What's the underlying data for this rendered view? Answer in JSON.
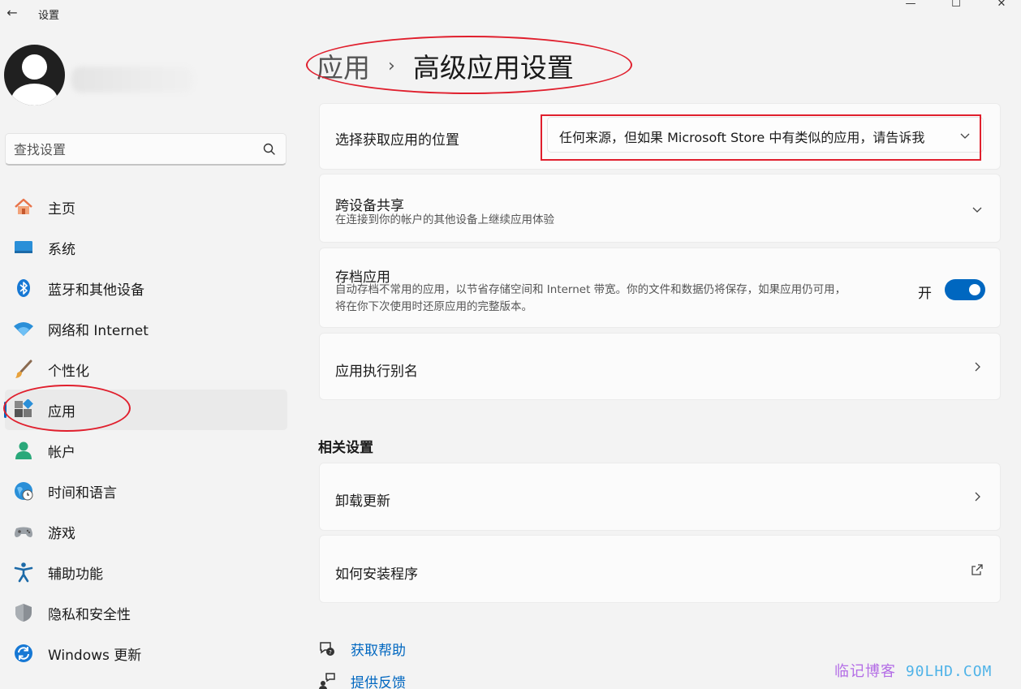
{
  "window": {
    "title": "设置",
    "back_glyph": "←",
    "minimize_glyph": "—",
    "maximize_glyph": "☐",
    "close_glyph": "✕"
  },
  "search": {
    "placeholder": "查找设置"
  },
  "sidebar": {
    "items": [
      {
        "label": "主页",
        "icon": "home-icon"
      },
      {
        "label": "系统",
        "icon": "system-icon"
      },
      {
        "label": "蓝牙和其他设备",
        "icon": "bluetooth-icon"
      },
      {
        "label": "网络和 Internet",
        "icon": "wifi-icon"
      },
      {
        "label": "个性化",
        "icon": "brush-icon"
      },
      {
        "label": "应用",
        "icon": "apps-icon",
        "active": true
      },
      {
        "label": "帐户",
        "icon": "account-icon"
      },
      {
        "label": "时间和语言",
        "icon": "time-language-icon"
      },
      {
        "label": "游戏",
        "icon": "gamepad-icon"
      },
      {
        "label": "辅助功能",
        "icon": "accessibility-icon"
      },
      {
        "label": "隐私和安全性",
        "icon": "shield-icon"
      },
      {
        "label": "Windows 更新",
        "icon": "update-icon"
      }
    ]
  },
  "breadcrumb": {
    "parent": "应用",
    "separator": "›",
    "current": "高级应用设置"
  },
  "settings": {
    "app_source": {
      "title": "选择获取应用的位置",
      "value": "任何来源，但如果 Microsoft Store 中有类似的应用，请告诉我"
    },
    "cross_device": {
      "title": "跨设备共享",
      "description": "在连接到你的帐户的其他设备上继续应用体验"
    },
    "archive_apps": {
      "title": "存档应用",
      "description_line1": "自动存档不常用的应用，以节省存储空间和 Internet 带宽。你的文件和数据仍将保存，如果应用仍可用，",
      "description_line2": "将在你下次使用时还原应用的完整版本。",
      "toggle_label": "开",
      "toggle_on": true
    },
    "aliases": {
      "title": "应用执行别名"
    }
  },
  "related": {
    "heading": "相关设置",
    "uninstall_updates": "卸载更新",
    "how_to_install": "如何安装程序"
  },
  "help": {
    "get_help": "获取帮助",
    "feedback": "提供反馈"
  },
  "watermark": {
    "cn": "临记博客",
    "en": " 90LHD.COM"
  },
  "colors": {
    "accent": "#0067c0",
    "annotation": "#e01f2d"
  }
}
